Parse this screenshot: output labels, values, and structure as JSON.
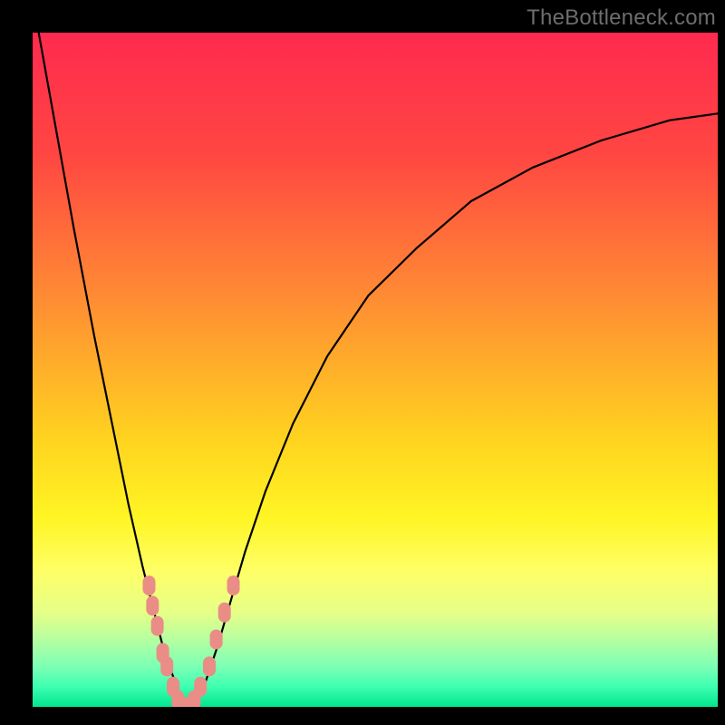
{
  "watermark": "TheBottleneck.com",
  "colors": {
    "frame": "#000000",
    "curve_stroke": "#000000",
    "marker_fill": "#e98d86",
    "gradient_stops": [
      {
        "offset": 0.0,
        "color": "#ff2a4f"
      },
      {
        "offset": 0.18,
        "color": "#ff4642"
      },
      {
        "offset": 0.4,
        "color": "#ff8e33"
      },
      {
        "offset": 0.6,
        "color": "#ffd21f"
      },
      {
        "offset": 0.72,
        "color": "#fff524"
      },
      {
        "offset": 0.8,
        "color": "#feff68"
      },
      {
        "offset": 0.86,
        "color": "#e6ff87"
      },
      {
        "offset": 0.9,
        "color": "#b6ffa0"
      },
      {
        "offset": 0.94,
        "color": "#7dffb4"
      },
      {
        "offset": 0.97,
        "color": "#3effb1"
      },
      {
        "offset": 1.0,
        "color": "#00e68f"
      }
    ]
  },
  "chart_data": {
    "type": "line",
    "title": "",
    "xlabel": "",
    "ylabel": "",
    "xlim": [
      0,
      100
    ],
    "ylim": [
      0,
      100
    ],
    "grid": false,
    "legend": false,
    "x": [
      0,
      3,
      6,
      9,
      12,
      14,
      16,
      18,
      19,
      20,
      21,
      22,
      23,
      24,
      25,
      27,
      29,
      31,
      34,
      38,
      43,
      49,
      56,
      64,
      73,
      83,
      93,
      100
    ],
    "series": [
      {
        "name": "bottleneck-curve",
        "values": [
          105,
          88,
          71,
          55,
          40,
          30,
          21,
          13,
          9,
          6,
          3,
          1,
          0,
          1,
          3,
          9,
          16,
          23,
          32,
          42,
          52,
          61,
          68,
          75,
          80,
          84,
          87,
          88
        ]
      }
    ],
    "markers": {
      "name": "highlighted-points",
      "points": [
        {
          "x": 17.0,
          "y": 18
        },
        {
          "x": 17.5,
          "y": 15
        },
        {
          "x": 18.2,
          "y": 12
        },
        {
          "x": 19.0,
          "y": 8
        },
        {
          "x": 19.6,
          "y": 6
        },
        {
          "x": 20.5,
          "y": 3
        },
        {
          "x": 21.2,
          "y": 1
        },
        {
          "x": 22.0,
          "y": 0
        },
        {
          "x": 22.8,
          "y": 0
        },
        {
          "x": 23.6,
          "y": 1
        },
        {
          "x": 24.5,
          "y": 3
        },
        {
          "x": 25.8,
          "y": 6
        },
        {
          "x": 26.8,
          "y": 10
        },
        {
          "x": 28.0,
          "y": 14
        },
        {
          "x": 29.3,
          "y": 18
        }
      ]
    }
  }
}
